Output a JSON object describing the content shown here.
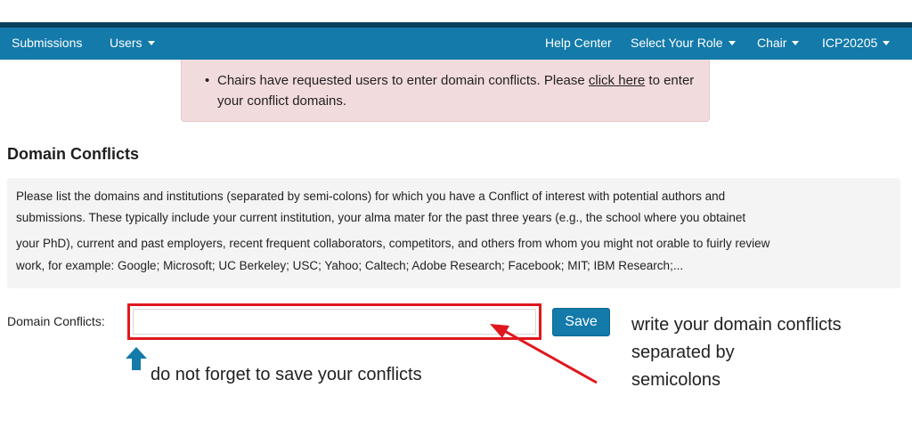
{
  "navbar": {
    "left": [
      {
        "label": "Submissions",
        "dropdown": false
      },
      {
        "label": "Users",
        "dropdown": true
      }
    ],
    "right": [
      {
        "label": "Help Center",
        "dropdown": false
      },
      {
        "label": "Select Your Role",
        "dropdown": true
      },
      {
        "label": "Chair",
        "dropdown": true
      },
      {
        "label": "ICP20205",
        "dropdown": true
      }
    ],
    "color": "#137aa9"
  },
  "alert": {
    "text_before": "Chairs have requested users to enter domain conflicts. Please ",
    "link": "click here",
    "text_after": " to enter your conflict domains.",
    "background": "#f2dbdd"
  },
  "section": {
    "title": "Domain Conflicts",
    "info_lines": [
      "Please list the domains and institutions (separated by semi-colons) for which you have a Conflict of interest with potential authors and",
      "submissions. These typically include your current institution, your alma mater for the past three years (e.g., the school where you obtainet",
      "your PhD), current and past employers, recent frequent collaborators, competitors, and others from whom you might not orable to fuirly review",
      "work, for example: Google; Microsoft; UC Berkeley; USC; Yahoo; Caltech; Adobe Research; Facebook; MIT; IBM Research;..."
    ]
  },
  "form": {
    "label": "Domain Conflicts:",
    "value": "",
    "placeholder": "",
    "save_label": "Save"
  },
  "annotations": {
    "right_lines": [
      "write your domain conflicts",
      "separated by",
      "semicolons"
    ],
    "bottom": "do not forget to save your conflicts",
    "highlight_color": "#e0181d",
    "arrow_up_color": "#137aa9"
  }
}
